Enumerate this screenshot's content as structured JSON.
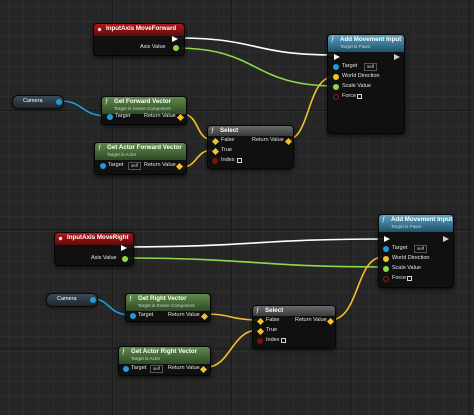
{
  "colors": {
    "vector_wire": "#f2c12e",
    "object_wire": "#1f9bd9",
    "float_wire": "#8bd94a",
    "exec_wire": "#ffffff",
    "event_header": "#a01616",
    "function_header": "#4f7a3c",
    "call_header": "#3d86a8"
  },
  "forward": {
    "event": {
      "title": "InputAxis MoveForward",
      "axis_value": "Axis Value"
    },
    "camera": {
      "label": "Camera"
    },
    "get_forward": {
      "title": "Get Forward Vector",
      "subtitle": "Target is Scene Component",
      "target": "Target",
      "return_value": "Return Value"
    },
    "get_actor_forward": {
      "title": "Get Actor Forward Vector",
      "subtitle": "Target is Actor",
      "target": "Target",
      "self": "self",
      "return_value": "Return Value"
    },
    "select": {
      "title": "Select",
      "false": "False",
      "true": "True",
      "index": "Index",
      "return_value": "Return Value"
    },
    "add_movement": {
      "title": "Add Movement Input",
      "subtitle": "Target is Pawn",
      "target": "Target",
      "self": "self",
      "world_direction": "World Direction",
      "scale_value": "Scale Value",
      "force": "Force"
    }
  },
  "right": {
    "event": {
      "title": "InputAxis MoveRight",
      "axis_value": "Axis Value"
    },
    "camera": {
      "label": "Camera"
    },
    "get_right": {
      "title": "Get Right Vector",
      "subtitle": "Target is Scene Component",
      "target": "Target",
      "return_value": "Return Value"
    },
    "get_actor_right": {
      "title": "Get Actor Right Vector",
      "subtitle": "Target is Actor",
      "target": "Target",
      "self": "self",
      "return_value": "Return Value"
    },
    "select": {
      "title": "Select",
      "false": "False",
      "true": "True",
      "index": "Index",
      "return_value": "Return Value"
    },
    "add_movement": {
      "title": "Add Movement Input",
      "subtitle": "Target is Pawn",
      "target": "Target",
      "self": "self",
      "world_direction": "World Direction",
      "scale_value": "Scale Value",
      "force": "Force"
    }
  }
}
